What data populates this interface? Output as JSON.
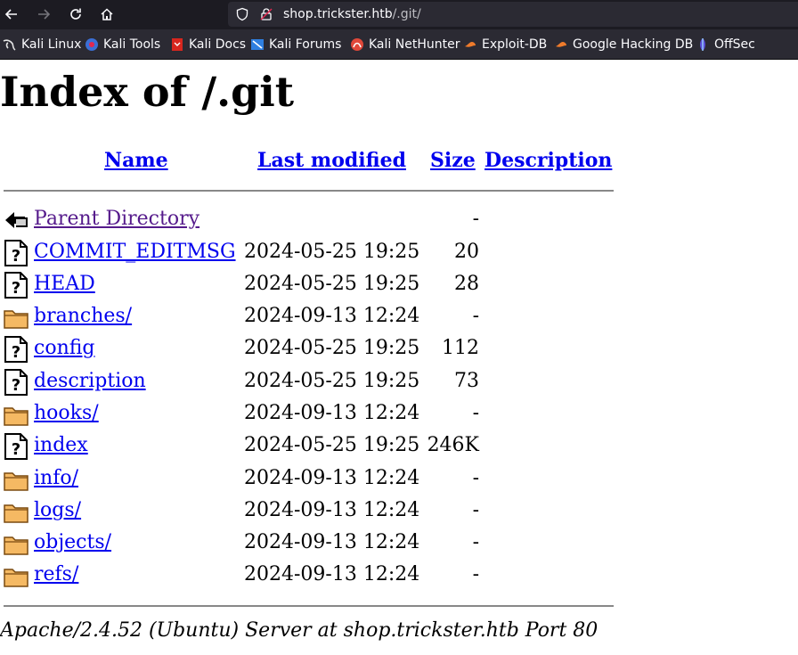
{
  "browser": {
    "url_host": "shop.trickster.htb",
    "url_path": "/.git/",
    "bookmarks": [
      {
        "label": "Kali Linux",
        "icon": "kali-dragon-icon"
      },
      {
        "label": "Kali Tools",
        "icon": "kali-tools-icon"
      },
      {
        "label": "Kali Docs",
        "icon": "kali-docs-icon"
      },
      {
        "label": "Kali Forums",
        "icon": "kali-forums-icon"
      },
      {
        "label": "Kali NetHunter",
        "icon": "kali-nethunter-icon"
      },
      {
        "label": "Exploit-DB",
        "icon": "exploit-db-icon"
      },
      {
        "label": "Google Hacking DB",
        "icon": "ghdb-icon"
      },
      {
        "label": "OffSec",
        "icon": "offsec-icon"
      }
    ]
  },
  "page": {
    "title": "Index of /.git",
    "columns": {
      "name": "Name",
      "modified": "Last modified",
      "size": "Size",
      "description": "Description"
    },
    "entries": [
      {
        "name": "Parent Directory",
        "modified": "",
        "size": "-",
        "icon": "back-icon"
      },
      {
        "name": "COMMIT_EDITMSG",
        "modified": "2024-05-25 19:25",
        "size": "20",
        "icon": "unknown-file-icon"
      },
      {
        "name": "HEAD",
        "modified": "2024-05-25 19:25",
        "size": "28",
        "icon": "unknown-file-icon"
      },
      {
        "name": "branches/",
        "modified": "2024-09-13 12:24",
        "size": "-",
        "icon": "folder-icon"
      },
      {
        "name": "config",
        "modified": "2024-05-25 19:25",
        "size": "112",
        "icon": "unknown-file-icon"
      },
      {
        "name": "description",
        "modified": "2024-05-25 19:25",
        "size": "73",
        "icon": "unknown-file-icon"
      },
      {
        "name": "hooks/",
        "modified": "2024-09-13 12:24",
        "size": "-",
        "icon": "folder-icon"
      },
      {
        "name": "index",
        "modified": "2024-05-25 19:25",
        "size": "246K",
        "icon": "unknown-file-icon"
      },
      {
        "name": "info/",
        "modified": "2024-09-13 12:24",
        "size": "-",
        "icon": "folder-icon"
      },
      {
        "name": "logs/",
        "modified": "2024-09-13 12:24",
        "size": "-",
        "icon": "folder-icon"
      },
      {
        "name": "objects/",
        "modified": "2024-09-13 12:24",
        "size": "-",
        "icon": "folder-icon"
      },
      {
        "name": "refs/",
        "modified": "2024-09-13 12:24",
        "size": "-",
        "icon": "folder-icon"
      }
    ],
    "footer": "Apache/2.4.52 (Ubuntu) Server at shop.trickster.htb Port 80"
  },
  "colors": {
    "link": "#0000ee",
    "visited": "#551a8b",
    "chrome_dark": "#1c1b22",
    "chrome_bar": "#2b2a33"
  }
}
